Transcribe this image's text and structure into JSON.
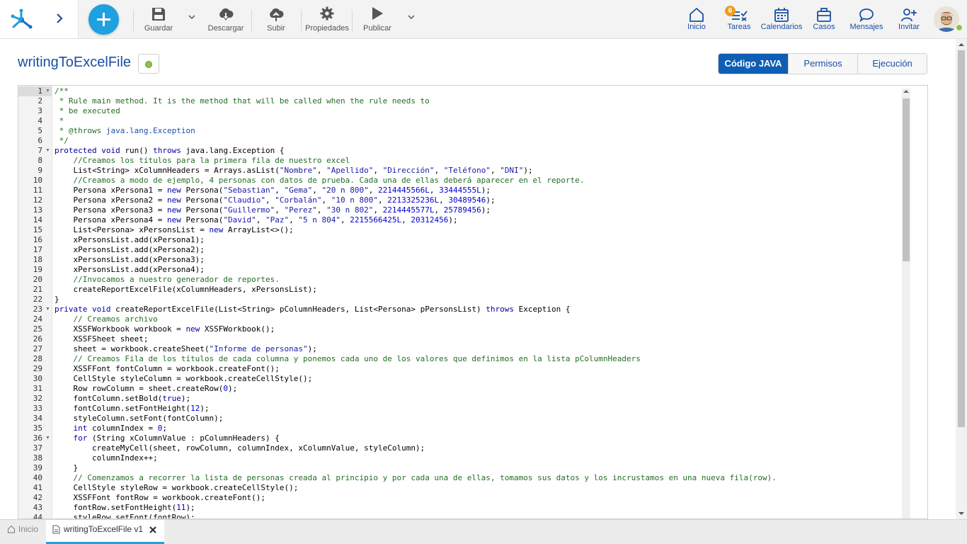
{
  "toolbar": {
    "save_label": "Guardar",
    "download_label": "Descargar",
    "upload_label": "Subir",
    "properties_label": "Propiedades",
    "publish_label": "Publicar"
  },
  "nav": {
    "home_label": "Inicio",
    "tasks_label": "Tareas",
    "tasks_badge": "6",
    "calendars_label": "Calendarios",
    "cases_label": "Casos",
    "messages_label": "Mensajes",
    "invite_label": "Invitar"
  },
  "page": {
    "title": "writingToExcelFile",
    "tabs": [
      "Código JAVA",
      "Permisos",
      "Ejecución"
    ],
    "active_tab": "Código JAVA"
  },
  "colors": {
    "accent": "#1da1e0",
    "primary": "#0d5eb4",
    "status": "#8bc34a",
    "badge": "#f19c1b"
  },
  "editor": {
    "language": "java",
    "lines": [
      "/**",
      " * Rule main method. It is the method that will be called when the rule needs to",
      " * be executed",
      " *",
      " * @throws java.lang.Exception",
      " */",
      "protected void run() throws java.lang.Exception {",
      "    //Creamos los títulos para la primera fila de nuestro excel",
      "    List<String> xColumnHeaders = Arrays.asList(\"Nombre\", \"Apellido\", \"Dirección\", \"Teléfono\", \"DNI\");",
      "    //Creamos a modo de ejemplo, 4 personas con datos de prueba. Cada una de ellas deberá aparecer en el reporte.",
      "    Persona xPersona1 = new Persona(\"Sebastian\", \"Gema\", \"20 n 800\", 2214445566L, 33444555L);",
      "    Persona xPersona2 = new Persona(\"Claudio\", \"Corbalán\", \"10 n 800\", 2213325236L, 30489546);",
      "    Persona xPersona3 = new Persona(\"Guillermo\", \"Perez\", \"30 n 802\", 2214445577L, 25789456);",
      "    Persona xPersona4 = new Persona(\"David\", \"Paz\", \"5 n 804\", 2215566425L, 20312456);",
      "    List<Persona> xPersonsList = new ArrayList<>();",
      "    xPersonsList.add(xPersona1);",
      "    xPersonsList.add(xPersona2);",
      "    xPersonsList.add(xPersona3);",
      "    xPersonsList.add(xPersona4);",
      "    //Invocamos a nuestro generador de reportes.",
      "    createReportExcelFile(xColumnHeaders, xPersonsList);",
      "}",
      "private void createReportExcelFile(List<String> pColumnHeaders, List<Persona> pPersonsList) throws Exception {",
      "    // Creamos archivo",
      "    XSSFWorkbook workbook = new XSSFWorkbook();",
      "    XSSFSheet sheet;",
      "    sheet = workbook.createSheet(\"Informe de personas\");",
      "    // Creamos Fila de los títulos de cada columna y ponemos cada uno de los valores que definimos en la lista pColumnHeaders",
      "    XSSFFont fontColumn = workbook.createFont();",
      "    CellStyle styleColumn = workbook.createCellStyle();",
      "    Row rowColumn = sheet.createRow(0);",
      "    fontColumn.setBold(true);",
      "    fontColumn.setFontHeight(12);",
      "    styleColumn.setFont(fontColumn);",
      "    int columnIndex = 0;",
      "    for (String xColumnValue : pColumnHeaders) {",
      "        createMyCell(sheet, rowColumn, columnIndex, xColumnValue, styleColumn);",
      "        columnIndex++;",
      "    }",
      "    // Comenzamos a recorrer la lista de personas creada al principio y por cada una de ellas, tomamos sus datos y los incrustamos en una nueva fila(row).",
      "    CellStyle styleRow = workbook.createCellStyle();",
      "    XSSFFont fontRow = workbook.createFont();",
      "    fontRow.setFontHeight(11);",
      "    styleRow.setFont(fontRow);"
    ],
    "fold_lines": [
      1,
      7,
      23,
      36
    ]
  },
  "bottom": {
    "home_label": "Inicio",
    "file_tab_label": "writingToExcelFile v1"
  }
}
